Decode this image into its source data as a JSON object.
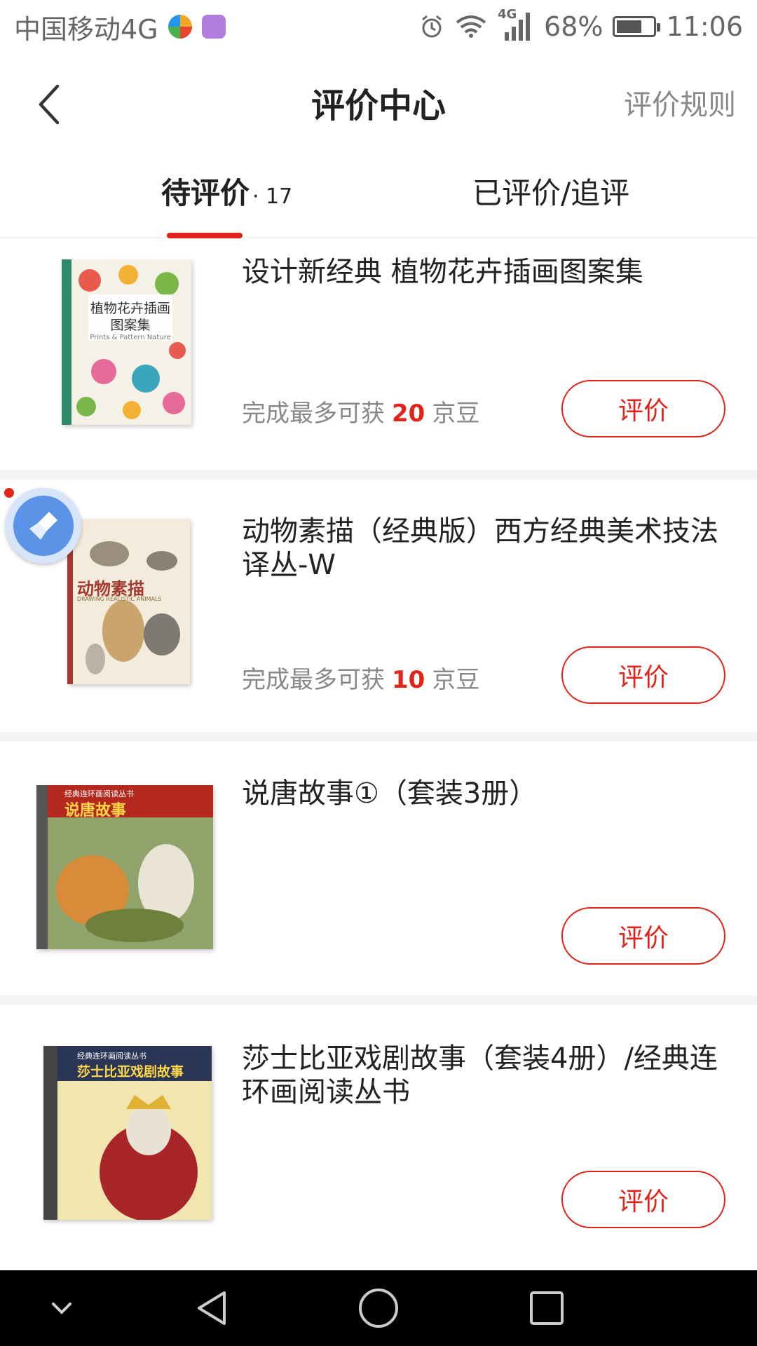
{
  "status_bar": {
    "carrier": "中国移动4G",
    "network_badge": "4G",
    "battery_percent": "68%",
    "battery_level": 0.68,
    "time": "11:06",
    "icons": [
      "alarm-icon",
      "wifi-icon",
      "signal-icon",
      "battery-icon"
    ]
  },
  "header": {
    "title": "评价中心",
    "rules_link": "评价规则",
    "back_icon": "chevron-left-icon"
  },
  "tabs": {
    "pending_label": "待评价",
    "pending_count": "· 17",
    "done_label": "已评价/追评",
    "active": "pending"
  },
  "items": [
    {
      "title": "设计新经典 植物花卉插画图案集",
      "cover_text": "植物花卉插画图案集",
      "cover_subtext": "Prints & Pattern Nature",
      "reward_prefix": "完成最多可获",
      "reward_value": "20",
      "reward_suffix": "京豆",
      "button": "评价"
    },
    {
      "title": "动物素描（经典版）西方经典美术技法译丛-W",
      "cover_text": "动物素描",
      "cover_subtext": "DRAWING REALISTIC ANIMALS",
      "reward_prefix": "完成最多可获",
      "reward_value": "10",
      "reward_suffix": "京豆",
      "button": "评价"
    },
    {
      "title": "说唐故事①（套装3册）",
      "cover_text": "说唐故事",
      "cover_series": "经典连环画阅读丛书",
      "button": "评价"
    },
    {
      "title": "莎士比亚戏剧故事（套装4册）/经典连环画阅读丛书",
      "cover_text": "莎士比亚戏剧故事",
      "cover_series": "经典连环画阅读丛书",
      "button": "评价"
    }
  ],
  "floating_button": {
    "icon": "broom-icon"
  },
  "system_nav": {
    "icons": [
      "chevron-down-icon",
      "back-triangle-icon",
      "home-circle-icon",
      "recents-square-icon"
    ]
  },
  "colors": {
    "accent": "#e2231a",
    "muted_text": "#888888",
    "separator": "#f5f5f5",
    "nav_bar_bg": "#000000"
  }
}
